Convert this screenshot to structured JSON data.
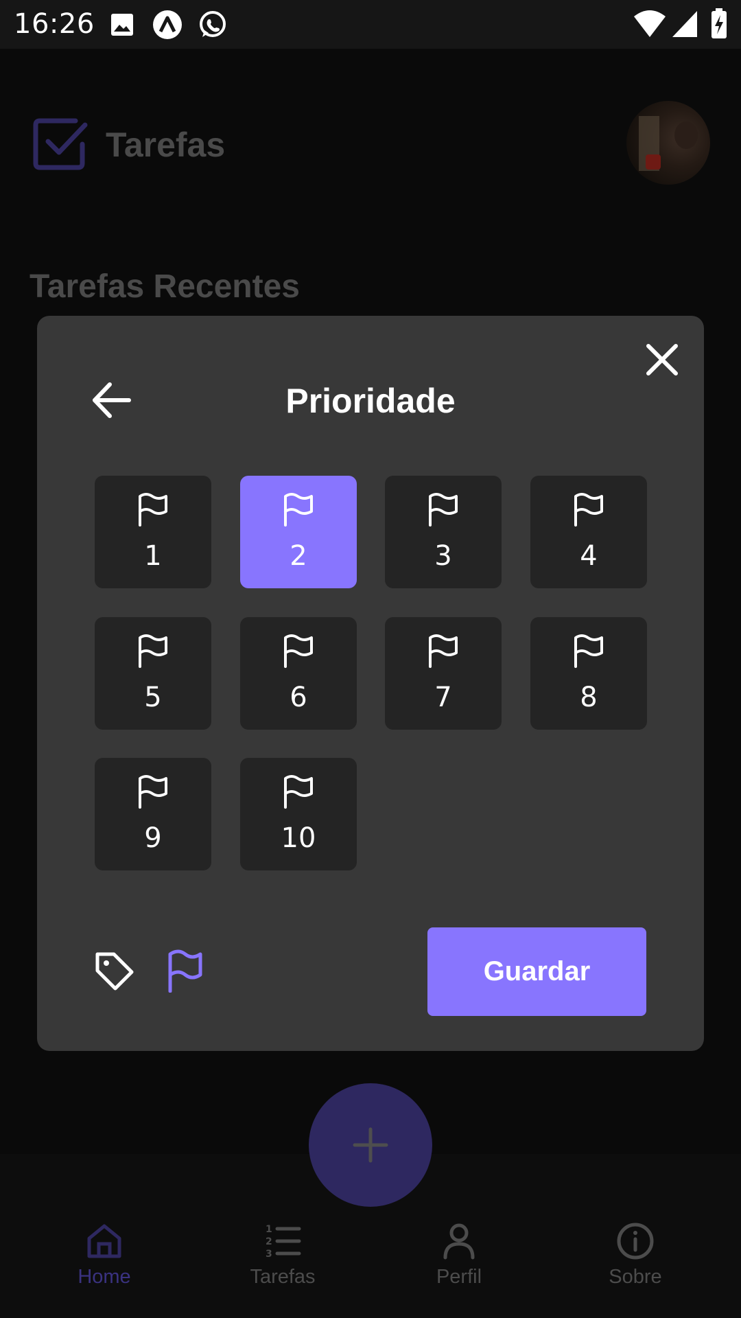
{
  "status_bar": {
    "time": "16:26"
  },
  "header": {
    "title": "Tarefas"
  },
  "section": {
    "title": "Tarefas Recentes"
  },
  "modal": {
    "title": "Prioridade",
    "selected": "2",
    "priorities": [
      "1",
      "2",
      "3",
      "4",
      "5",
      "6",
      "7",
      "8",
      "9",
      "10"
    ],
    "save_label": "Guardar"
  },
  "nav": {
    "items": [
      {
        "label": "Home",
        "icon": "home-icon",
        "active": true
      },
      {
        "label": "Tarefas",
        "icon": "list-icon",
        "active": false
      },
      {
        "label": "Perfil",
        "icon": "user-icon",
        "active": false
      },
      {
        "label": "Sobre",
        "icon": "info-icon",
        "active": false
      }
    ]
  },
  "colors": {
    "accent": "#8875fe",
    "modal_bg": "#383838",
    "tile_bg": "#242424"
  }
}
